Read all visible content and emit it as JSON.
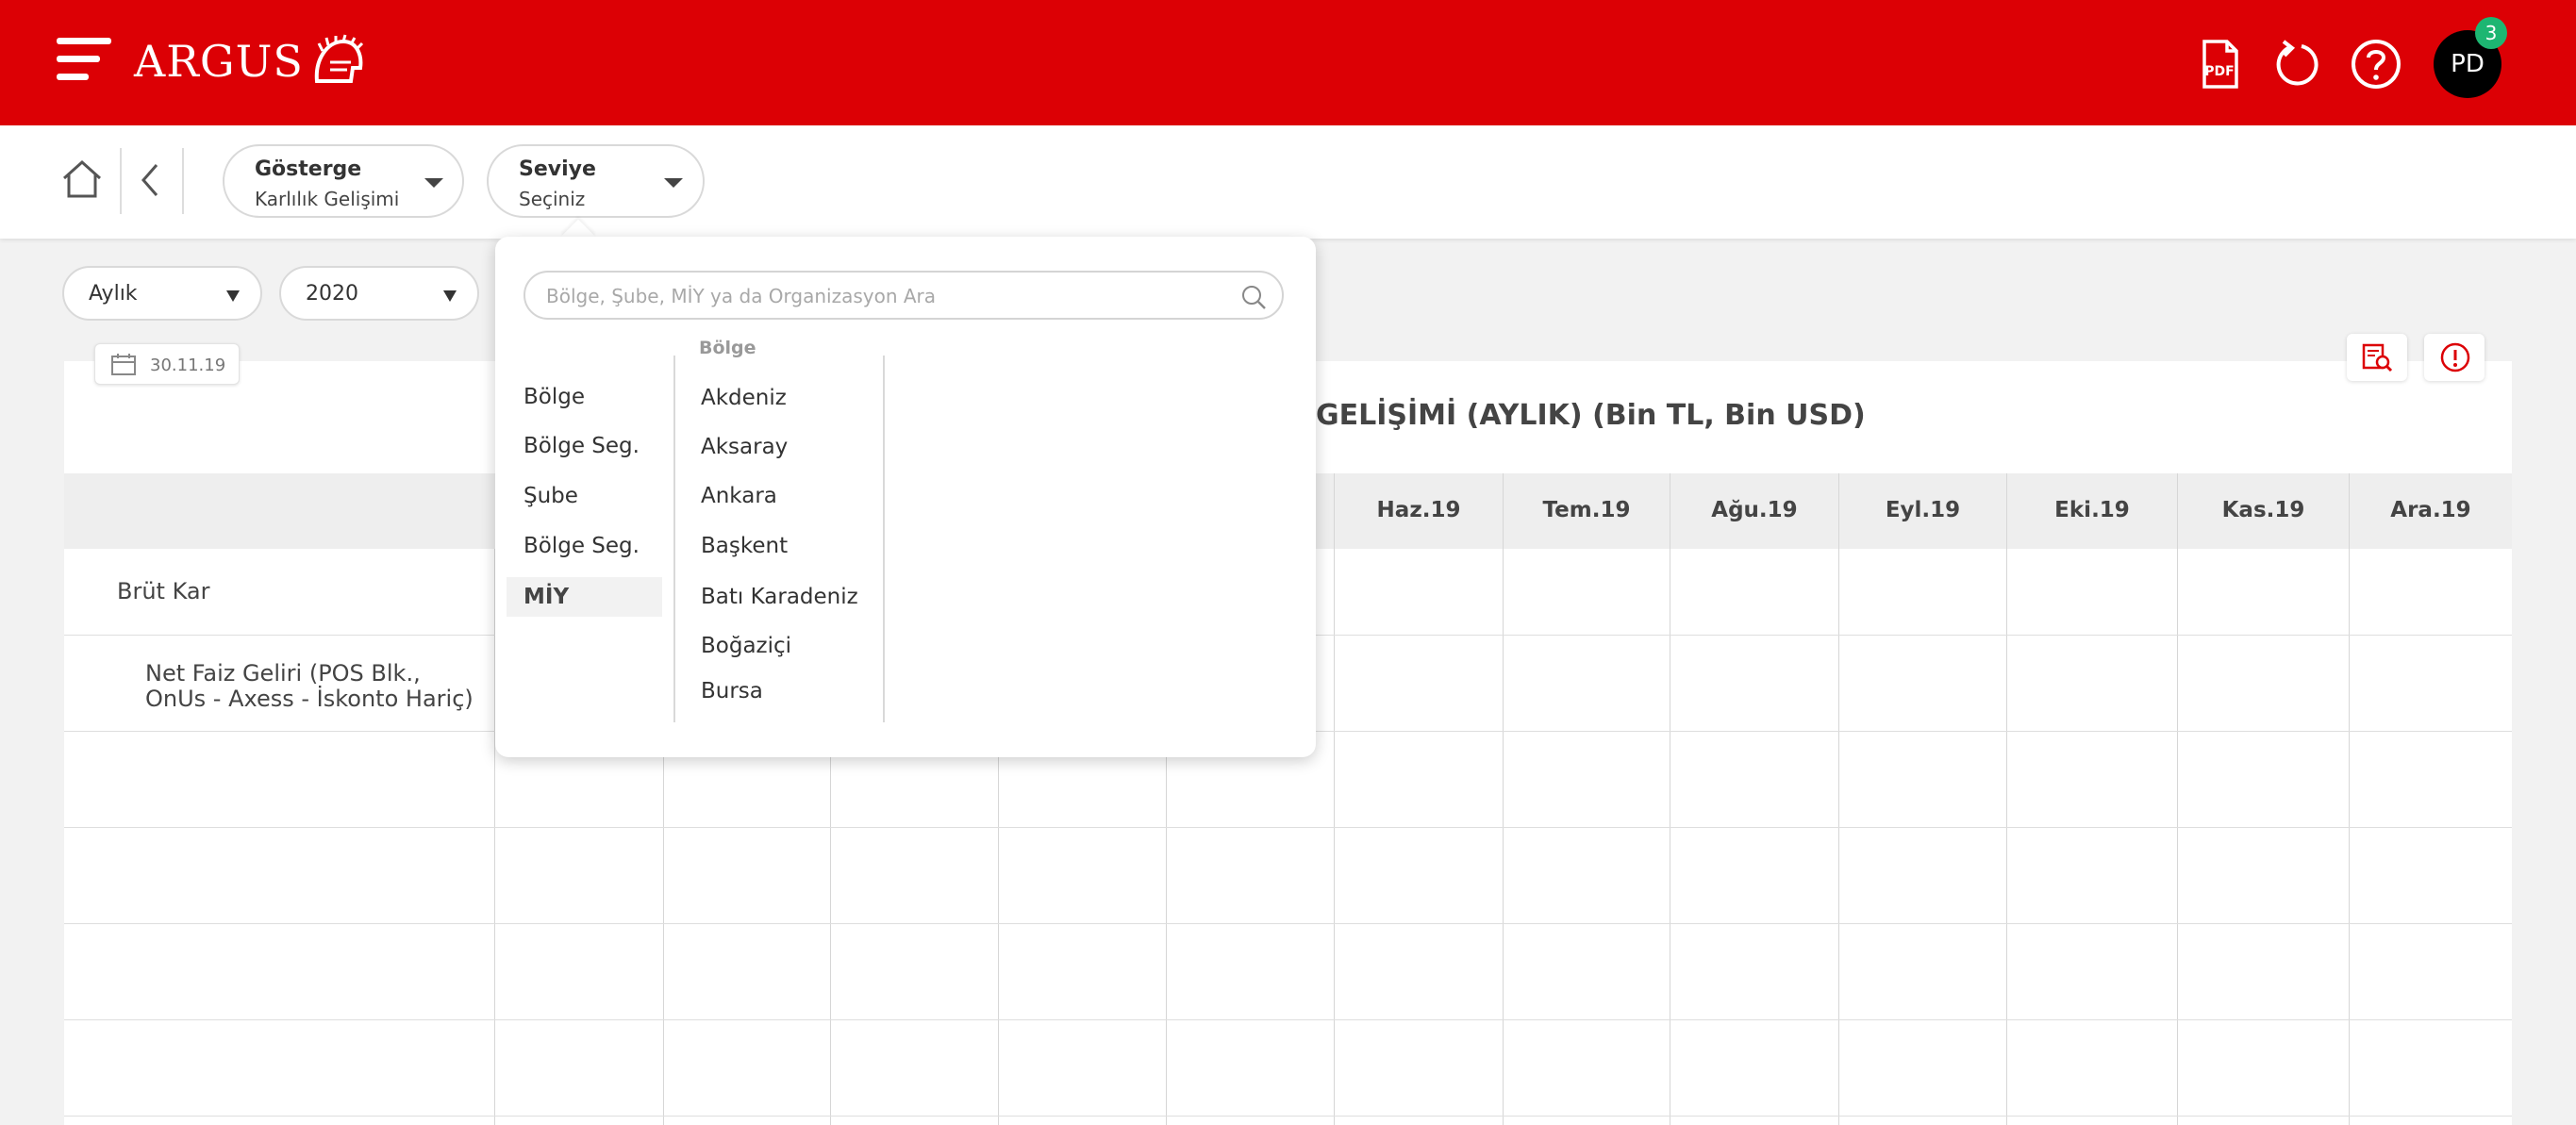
{
  "header": {
    "logo_text": "ARGUS",
    "pdf_label": "PDF",
    "avatar_initials": "PD",
    "notification_count": "3",
    "brand_color": "#dc0005"
  },
  "toolbar": {
    "gosterge": {
      "title": "Gösterge",
      "value": "Karlılık Gelişimi"
    },
    "seviye": {
      "title": "Seviye",
      "value": "Seçiniz"
    }
  },
  "filters": {
    "period": "Aylık",
    "year": "2020"
  },
  "report": {
    "date": "30.11.19",
    "title": "GELİŞİMİ (AYLIK)  (Bin TL, Bin USD)",
    "columns": [
      "Haz.19",
      "Tem.19",
      "Ağu.19",
      "Eyl.19",
      "Eki.19",
      "Kas.19",
      "Ara.19"
    ],
    "rows": [
      {
        "label": "Brüt Kar"
      },
      {
        "label_line1": "Net Faiz Geliri (POS Blk.,",
        "label_line2": "OnUs - Axess - İskonto Hariç)"
      }
    ]
  },
  "popup": {
    "search_placeholder": "Bölge, Şube, MİY ya da Organizasyon Ara",
    "levels": [
      "Bölge",
      "Bölge Seg.",
      "Şube",
      "Bölge Seg.",
      "MİY"
    ],
    "active_level": "MİY",
    "region_header": "Bölge",
    "regions": [
      "Akdeniz",
      "Aksaray",
      "Ankara",
      "Başkent",
      "Batı Karadeniz",
      "Boğaziçi",
      "Bursa"
    ]
  }
}
